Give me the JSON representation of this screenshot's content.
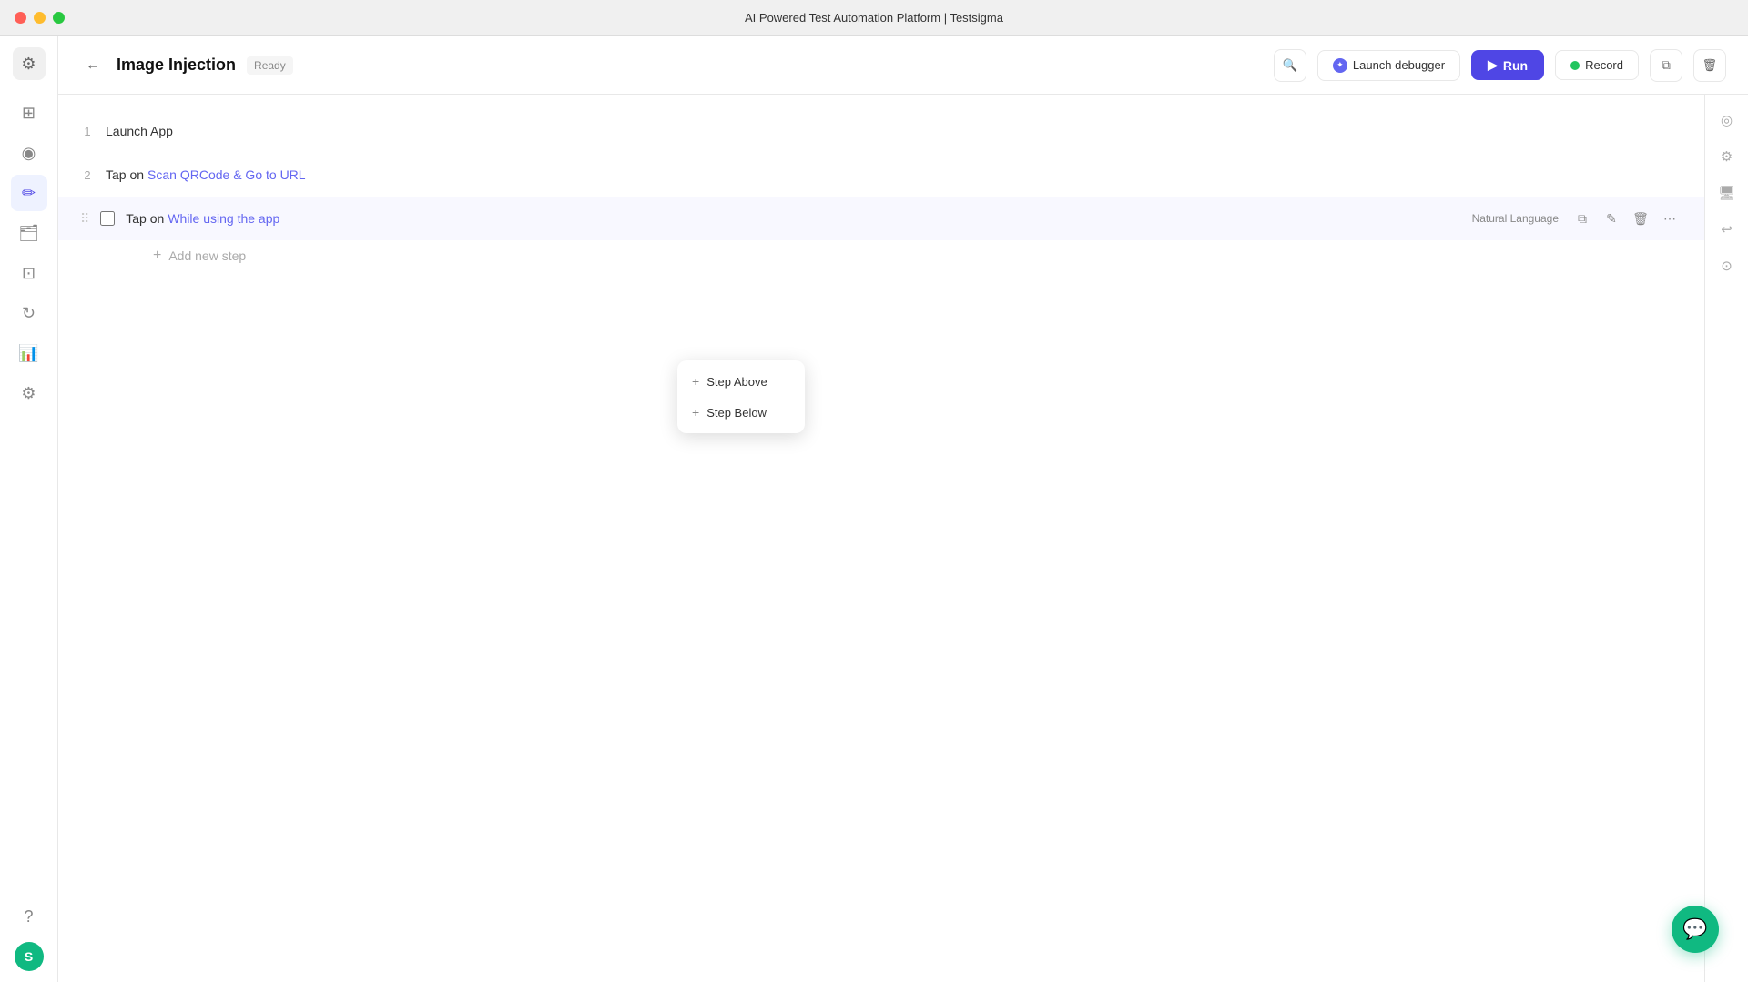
{
  "titleBar": {
    "title": "AI Powered Test Automation Platform | Testsigma"
  },
  "header": {
    "backLabel": "←",
    "pageTitle": "Image Injection",
    "statusBadge": "Ready",
    "searchTooltip": "Search",
    "launchDebuggerLabel": "Launch debugger",
    "runLabel": "Run",
    "recordLabel": "Record"
  },
  "sidebar": {
    "logoIcon": "⚙",
    "items": [
      {
        "icon": "⊞",
        "name": "grid-icon",
        "active": false
      },
      {
        "icon": "◎",
        "name": "monitor-icon",
        "active": false
      },
      {
        "icon": "✏",
        "name": "edit-icon",
        "active": true
      },
      {
        "icon": "🗂",
        "name": "folders-icon",
        "active": false
      },
      {
        "icon": "⊡",
        "name": "apps-icon",
        "active": false
      },
      {
        "icon": "↻",
        "name": "refresh-icon",
        "active": false
      },
      {
        "icon": "📊",
        "name": "chart-icon",
        "active": false
      },
      {
        "icon": "⚙",
        "name": "settings-icon",
        "active": false
      }
    ],
    "helpIcon": "?",
    "avatar": "S"
  },
  "rightPanel": {
    "icons": [
      {
        "name": "eye-icon",
        "symbol": "👁"
      },
      {
        "name": "settings-icon",
        "symbol": "⚙"
      },
      {
        "name": "monitor-icon",
        "symbol": "🖥"
      },
      {
        "name": "undo-icon",
        "symbol": "↩"
      },
      {
        "name": "eye2-icon",
        "symbol": "⊙"
      }
    ]
  },
  "steps": [
    {
      "number": "1",
      "action": "Launch App",
      "target": "",
      "hasCheckbox": false
    },
    {
      "number": "2",
      "action": "Tap on",
      "target": "Scan QRCode & Go to URL",
      "hasCheckbox": false
    },
    {
      "number": "",
      "action": "Tap on",
      "target": "While using the app",
      "hasCheckbox": true,
      "active": true,
      "actionLabel": "Natural Language"
    }
  ],
  "contextMenu": {
    "stepAbove": "+ Step Above",
    "stepBelow": "+ Step Below"
  },
  "addNewStep": {
    "label": "Add new step",
    "plusIcon": "+"
  },
  "chatFab": {
    "icon": "💬"
  }
}
